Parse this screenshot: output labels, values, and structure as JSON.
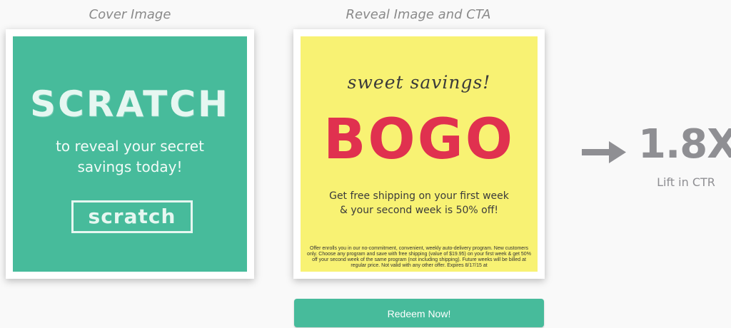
{
  "captions": {
    "cover": "Cover Image",
    "reveal": "Reveal Image and CTA"
  },
  "cover": {
    "title": "SCRATCH",
    "subtitle_line1": "to reveal your secret",
    "subtitle_line2": "savings today!",
    "button_label": "scratch"
  },
  "reveal": {
    "tagline": "sweet savings!",
    "headline": "BOGO",
    "offer_line1": "Get free shipping on your first week",
    "offer_line2": "& your second week is 50% off!",
    "fine_print": "Offer enrolls you in our no-commitment, convenient, weekly auto-delivery program. New customers only.  Choose any program and save with free shipping (value of $19.95) on your first week & get 50% off your second week of the same program (not including shipping). Future weeks will be billed at regular price. Not valid with any other offer. Expires 8/17/15 at"
  },
  "cta": {
    "label": "Redeem Now!"
  },
  "result": {
    "value": "1.8X",
    "label": "Lift in CTR"
  },
  "icons": {
    "arrow": "arrow-right-icon"
  },
  "colors": {
    "cover_bg": "#47bb9b",
    "reveal_bg": "#f8f273",
    "bogo": "#e0314f",
    "cta_bg": "#47bb9b",
    "stat": "#8f8f93"
  }
}
